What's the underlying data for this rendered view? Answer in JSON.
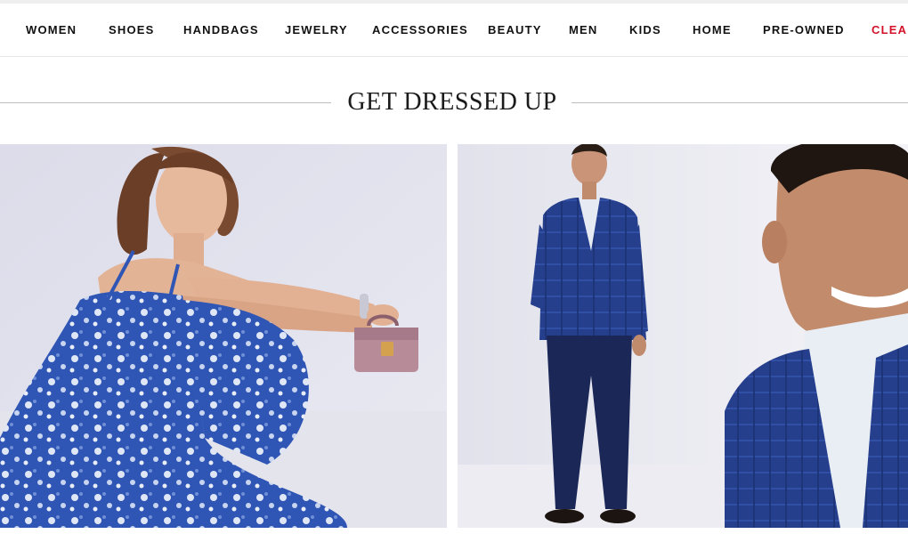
{
  "nav": {
    "items": [
      "WOMEN",
      "SHOES",
      "HANDBAGS",
      "JEWELRY",
      "ACCESSORIES",
      "BEAUTY",
      "MEN",
      "KIDS",
      "HOME",
      "PRE-OWNED"
    ],
    "sale_label": "CLEARANCE"
  },
  "section": {
    "title": "GET DRESSED UP"
  },
  "colors": {
    "accent_sale": "#d3122a",
    "text": "#111111",
    "dress_blue": "#2f55b5",
    "suit_navy": "#1c2f6e"
  }
}
